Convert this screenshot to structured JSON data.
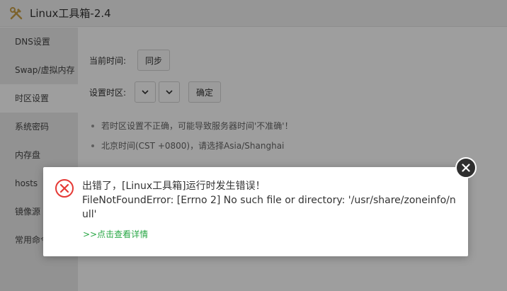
{
  "window": {
    "title": "Linux工具箱-2.4"
  },
  "sidebar": {
    "items": [
      {
        "label": "DNS设置"
      },
      {
        "label": "Swap/虚拟内存"
      },
      {
        "label": "时区设置"
      },
      {
        "label": "系统密码"
      },
      {
        "label": "内存盘"
      },
      {
        "label": "hosts"
      },
      {
        "label": "镜像源"
      },
      {
        "label": "常用命令"
      }
    ],
    "active_index": 2
  },
  "timezone": {
    "current_time_label": "当前时间:",
    "sync_button": "同步",
    "set_timezone_label": "设置时区:",
    "confirm_button": "确定",
    "tips": [
      "若时区设置不正确，可能导致服务器时间'不准确'！",
      "北京时间(CST +0800)，请选择Asia/Shanghai"
    ]
  },
  "error_dialog": {
    "heading": "出错了，[Linux工具箱]运行时发生错误！",
    "error_message": "FileNotFoundError: [Errno 2] No such file or directory: '/usr/share/zoneinfo/null'",
    "details_link": ">>点击查看详情",
    "icon": "error-x-icon",
    "accent_color": "#e53935",
    "link_color": "#28a745"
  }
}
